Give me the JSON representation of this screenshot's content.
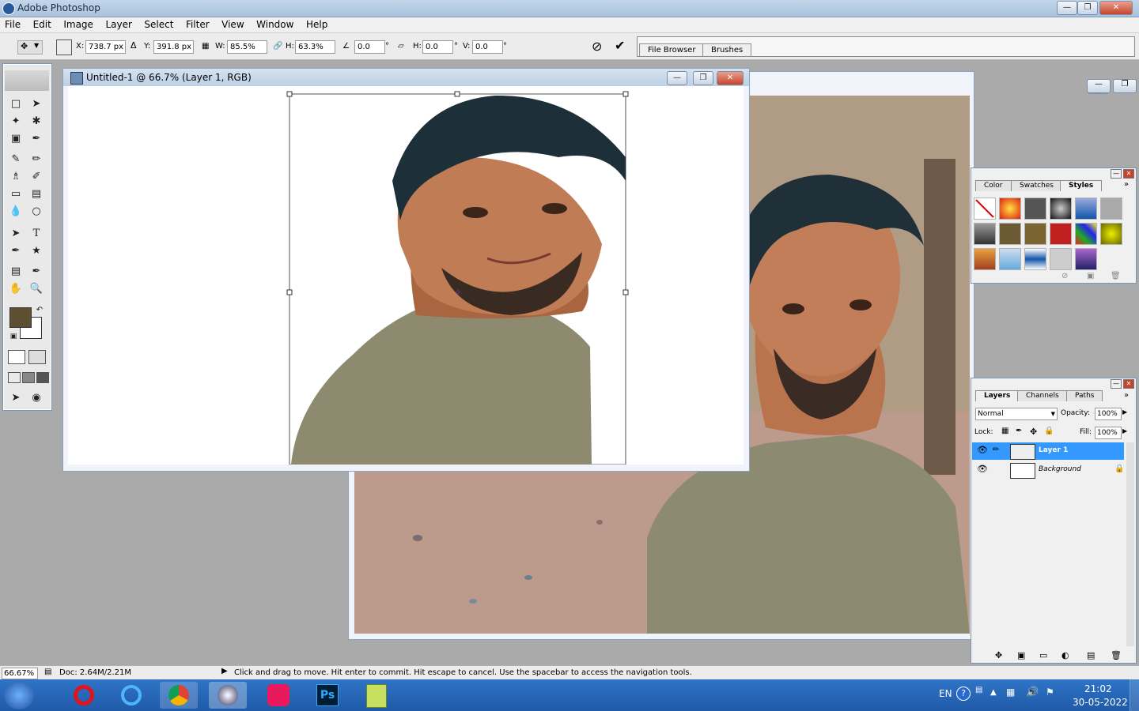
{
  "app": {
    "title": "Adobe Photoshop"
  },
  "menu": [
    "File",
    "Edit",
    "Image",
    "Layer",
    "Select",
    "Filter",
    "View",
    "Window",
    "Help"
  ],
  "options": {
    "x_label": "X:",
    "x_value": "738.7 px",
    "y_label": "Y:",
    "y_value": "391.8 px",
    "w_label": "W:",
    "w_value": "85.5%",
    "h_label": "H:",
    "h_value": "63.3%",
    "angle_value": "0.0",
    "hskew_label": "H:",
    "hskew_value": "0.0",
    "vskew_label": "V:",
    "vskew_value": "0.0",
    "file_browser_tab": "File Browser",
    "brushes_tab": "Brushes"
  },
  "document": {
    "title": "Untitled-1 @ 66.7% (Layer 1, RGB)"
  },
  "color_panel": {
    "tabs": [
      "Color",
      "Swatches",
      "Styles"
    ],
    "active": "Styles"
  },
  "layers_panel": {
    "tabs": [
      "Layers",
      "Channels",
      "Paths"
    ],
    "blend_mode": "Normal",
    "opacity_label": "Opacity:",
    "opacity_value": "100%",
    "lock_label": "Lock:",
    "fill_label": "Fill:",
    "fill_value": "100%",
    "layers": [
      {
        "name": "Layer 1",
        "selected": true
      },
      {
        "name": "Background",
        "selected": false
      }
    ]
  },
  "status": {
    "zoom": "66.67%",
    "doc": "Doc: 2.64M/2.21M",
    "hint": "Click and drag to move. Hit enter to commit. Hit escape to cancel. Use the spacebar to access the navigation tools."
  },
  "taskbar": {
    "lang": "EN",
    "time": "21:02",
    "date": "30-05-2022"
  },
  "colors": {
    "foreground": "#5e4e32",
    "background": "#ffffff",
    "selection": "#3399ff"
  }
}
